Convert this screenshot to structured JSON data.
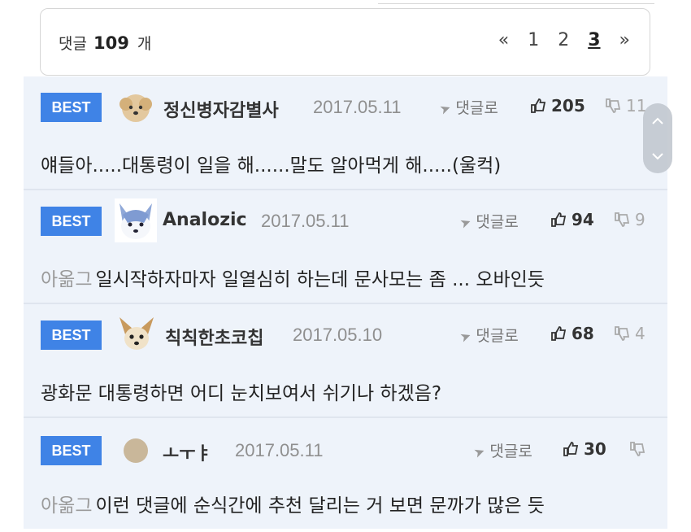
{
  "header": {
    "comment_label": "댓글",
    "comment_count": "109",
    "comment_unit": "개",
    "pager": {
      "prev": "«",
      "pages": [
        "1",
        "2",
        "3"
      ],
      "current": "3",
      "next": "»"
    }
  },
  "reply_label": "댓글로",
  "best_label": "BEST",
  "comments": [
    {
      "nick": "정신병자감별사",
      "date": "2017.05.11",
      "likes": "205",
      "dislikes": "11",
      "prefix": "",
      "text": "얘들아.....대통령이 일을 해......말도 알아먹게 해.....(울컥)",
      "avatar": "puppy-avatar"
    },
    {
      "nick": "Analozic",
      "date": "2017.05.11",
      "likes": "94",
      "dislikes": "9",
      "prefix": "아옮그",
      "text": "일시작하자마자 일열심히 하는데 문사모는 좀 ... 오바인듯",
      "avatar": "husky-avatar"
    },
    {
      "nick": "칙칙한초코칩",
      "date": "2017.05.10",
      "likes": "68",
      "dislikes": "4",
      "prefix": "",
      "text": "광화문 대통령하면 어디 눈치보여서 쉬기나 하겠음?",
      "avatar": "chihuahua-avatar"
    },
    {
      "nick": "ㅗㅜㅑ",
      "date": "2017.05.11",
      "likes": "30",
      "dislikes": "",
      "prefix": "아옮그",
      "text": "이런 댓글에 순식간에 추천 달리는 거 보면 문까가 많은 듯",
      "avatar": "circle-avatar"
    }
  ],
  "colors": {
    "badge": "#3f83e6",
    "list_bg": "#eef3fa"
  }
}
